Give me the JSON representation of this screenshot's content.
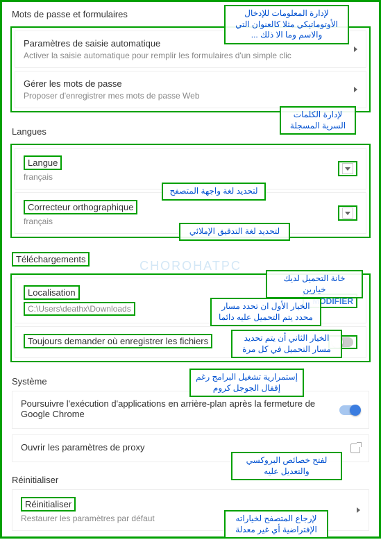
{
  "sections": {
    "passwords": {
      "header": "Mots de passe et formulaires",
      "autofill": {
        "title": "Paramètres de saisie automatique",
        "sub": "Activer la saisie automatique pour remplir les formulaires d'un simple clic"
      },
      "manage_pw": {
        "title": "Gérer les mots de passe",
        "sub": "Proposer d'enregistrer mes mots de passe Web"
      }
    },
    "languages": {
      "header": "Langues",
      "lang": {
        "title": "Langue",
        "value": "français"
      },
      "spell": {
        "title": "Correcteur orthographique",
        "value": "français"
      }
    },
    "downloads": {
      "header": "Téléchargements",
      "location": {
        "title": "Localisation",
        "value": "C:\\Users\\deathx\\Downloads",
        "button": "MODIFIER"
      },
      "ask": {
        "title": "Toujours demander où enregistrer les fichiers"
      }
    },
    "system": {
      "header": "Système",
      "bg": {
        "title": "Poursuivre l'exécution d'applications en arrière-plan après la fermeture de Google Chrome"
      },
      "proxy": {
        "title": "Ouvrir les paramètres de proxy"
      }
    },
    "reset": {
      "header": "Réinitialiser",
      "reset": {
        "title": "Réinitialiser",
        "sub": "Restaurer les paramètres par défaut"
      }
    }
  },
  "annotations": {
    "a1": "لإدارة المعلومات للإدخال الأوتوماتيكي مثلا كالعنوان التي والاسم وما الا ذلك ...",
    "a2": "لإدارة الكلمات السرية المسجلة",
    "a3": "لتحديد لغة واجهة المتصفح",
    "a4": "لتحديد لغة التدقيق الإملائي",
    "a5": "خانة التحميل لديك خيارين",
    "a6": "الخيار الأول ان تحدد مسار محدد يتم التحميل عليه دائما",
    "a7": "الخيار الثاني أن يتم تحديد مسار التحميل في كل مرة",
    "a8": "إستمرارية تشغيل البرامج رغم إقفال الجوجل كروم",
    "a9": "لفتح خصائص البروكسي والتعديل عليه",
    "a10": "لإرجاع المتصفح لخياراته الإفتراضية أي غير معدلة"
  },
  "watermark": "CHOROHATPC"
}
